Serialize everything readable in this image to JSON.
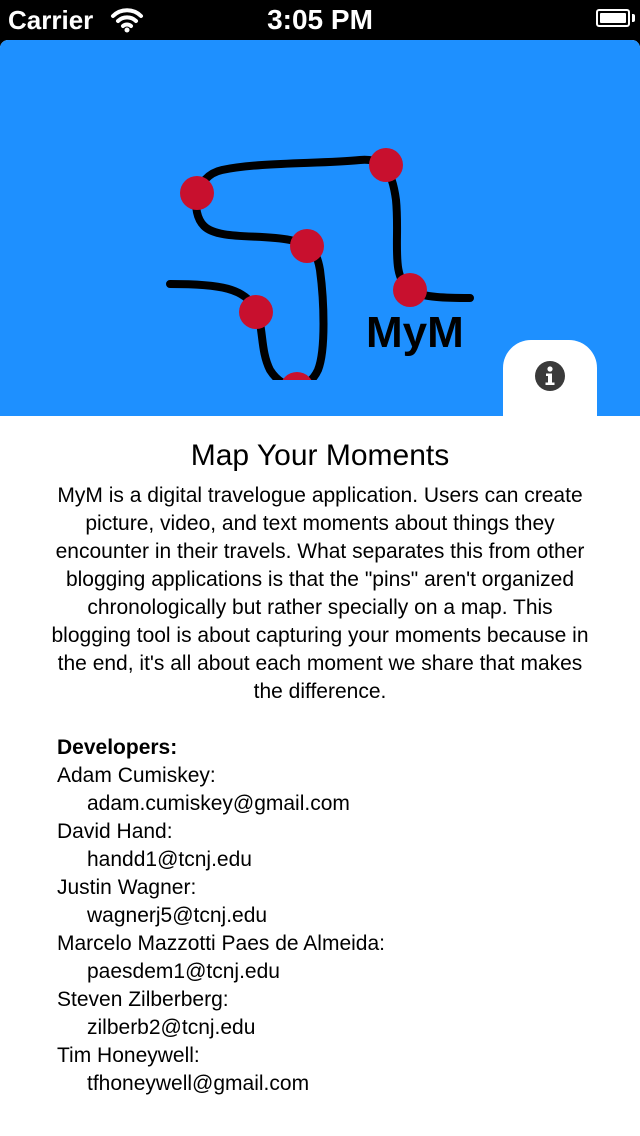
{
  "status_bar": {
    "carrier": "Carrier",
    "time": "3:05 PM",
    "icons": [
      "wifi-icon",
      "battery-icon"
    ]
  },
  "header": {
    "background_color": "#1e90ff",
    "logo_text": "MyM",
    "logo_dot_color": "#c8102e",
    "info_button_icon": "info-icon"
  },
  "main": {
    "title": "Map Your Moments",
    "description": "MyM is a digital travelogue application. Users can create picture, video, and text moments about things they encounter in their travels. What separates this from other blogging applications is that the \"pins\" aren't organized chronologically but rather specially on a map. This blogging tool is about capturing your moments because in the end, it's all about each moment we share that makes the difference."
  },
  "developers": {
    "heading": "Developers:",
    "list": [
      {
        "name": "Adam Cumiskey:",
        "email": "adam.cumiskey@gmail.com"
      },
      {
        "name": "David Hand:",
        "email": "handd1@tcnj.edu"
      },
      {
        "name": "Justin Wagner:",
        "email": "wagnerj5@tcnj.edu"
      },
      {
        "name": "Marcelo Mazzotti Paes de Almeida:",
        "email": "paesdem1@tcnj.edu"
      },
      {
        "name": "Steven Zilberberg:",
        "email": "zilberb2@tcnj.edu"
      },
      {
        "name": "Tim Honeywell:",
        "email": "tfhoneywell@gmail.com"
      }
    ]
  }
}
